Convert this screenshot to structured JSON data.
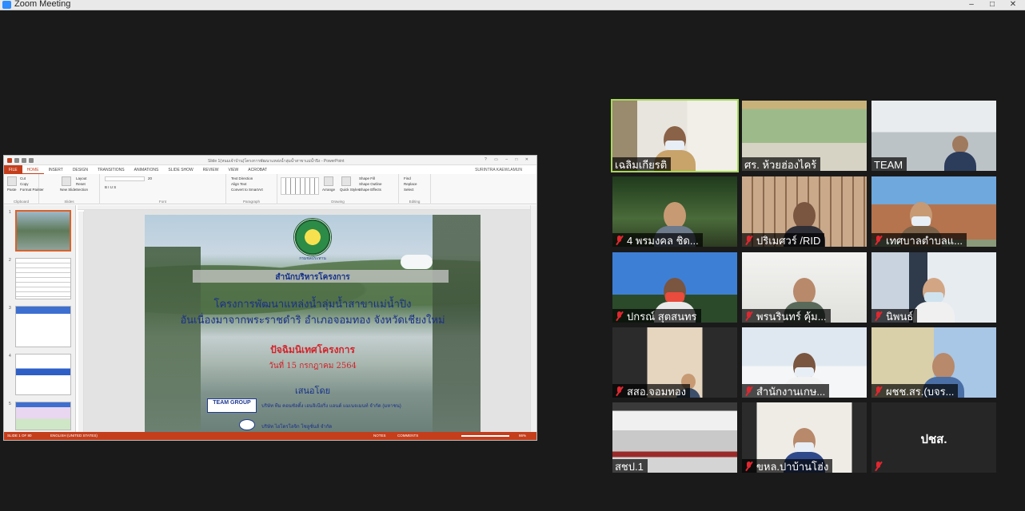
{
  "window": {
    "title": "Zoom Meeting",
    "controls": [
      "–",
      "□",
      "✕"
    ]
  },
  "powerpoint": {
    "doc_title": "Slide 1(หนมเจ้าบ้าน)โครงการพัฒนาแหล่งน้ำลุ่มน้ำสาขาแม่น้ำปิง - PowerPoint",
    "window_controls": "? ▭ – □ ✕",
    "tabs": [
      "FILE",
      "HOME",
      "INSERT",
      "DESIGN",
      "TRANSITIONS",
      "ANIMATIONS",
      "SLIDE SHOW",
      "REVIEW",
      "VIEW",
      "ACROBAT"
    ],
    "user": "SURINTRA KAEWLAMUN",
    "ribbon": {
      "clipboard": {
        "label": "Clipboard",
        "paste": "Paste",
        "cut": "Cut",
        "copy": "Copy",
        "format_painter": "Format Painter"
      },
      "slides": {
        "label": "Slides",
        "new_slide": "New Slide",
        "layout": "Layout",
        "reset": "Reset",
        "section": "Section"
      },
      "font": {
        "label": "Font",
        "size": "20"
      },
      "paragraph": {
        "label": "Paragraph",
        "text_direction": "Text Direction",
        "align_text": "Align Text",
        "smartart": "Convert to SmartArt"
      },
      "drawing": {
        "label": "Drawing",
        "arrange": "Arrange",
        "quick_styles": "Quick Styles",
        "shape_fill": "Shape Fill",
        "shape_outline": "Shape Outline",
        "shape_effects": "Shape Effects"
      },
      "editing": {
        "label": "Editing",
        "find": "Find",
        "replace": "Replace",
        "select": "Select"
      }
    },
    "thumb_numbers": [
      "1",
      "2",
      "3",
      "4",
      "5"
    ],
    "slide": {
      "logo_text": "กรมชลประทาน",
      "office": "สำนักบริหารโครงการ",
      "project_line1": "โครงการพัฒนาแหล่งน้ำลุ่มน้ำสาขาแม่น้ำปิง",
      "project_line2": "อันเนื่องมาจากพระราชดำริ อำเภอจอมทอง จังหวัดเชียงใหม่",
      "orientation": "ปัจฉิมนิเทศโครงการ",
      "date": "วันที่ 15 กรกฎาคม 2564",
      "presented_by": "เสนอโดย",
      "team_logo": "TEAM GROUP",
      "company1": "บริษัท ทีม คอนซัลติ้ง เอนจิเนียริ่ง แอนด์ แมเนจเมนท์ จำกัด (มหาชน)",
      "company2": "บริษัท ไฮโดรโลจิก โซลูชั่นส์ จำกัด"
    },
    "status": {
      "slide_of": "SLIDE 1 OF 80",
      "language": "ENGLISH (UNITED STATES)",
      "notes": "NOTES",
      "comments": "COMMENTS",
      "zoom": "66%"
    }
  },
  "participants": [
    {
      "name": "เฉลิมเกียรติ",
      "muted": false,
      "active": true
    },
    {
      "name": "ศร. ห้วยฮ่องไคร้",
      "muted": false
    },
    {
      "name": "TEAM",
      "muted": false
    },
    {
      "name": "4 พรมงคล ชิด...",
      "muted": true
    },
    {
      "name": "ปริเมศวร์ /RID",
      "muted": true
    },
    {
      "name": "เทศบาลตำบลแ...",
      "muted": true
    },
    {
      "name": "ปกรณ์ สุตสนทร",
      "muted": true
    },
    {
      "name": "พรนรินทร์ คุ้ม...",
      "muted": true
    },
    {
      "name": "นิพนธ์",
      "muted": true
    },
    {
      "name": "สสอ.จอมทอง",
      "muted": true
    },
    {
      "name": "สำนักงานเกษ...",
      "muted": true
    },
    {
      "name": "ผชช.สร.(บจร...",
      "muted": true
    },
    {
      "name": "สชป.1",
      "muted": false
    },
    {
      "name": "ขหล.ปาบ้านโฮ่ง",
      "muted": true
    },
    {
      "name": "ปชส.",
      "muted": true,
      "video_off": true
    }
  ]
}
